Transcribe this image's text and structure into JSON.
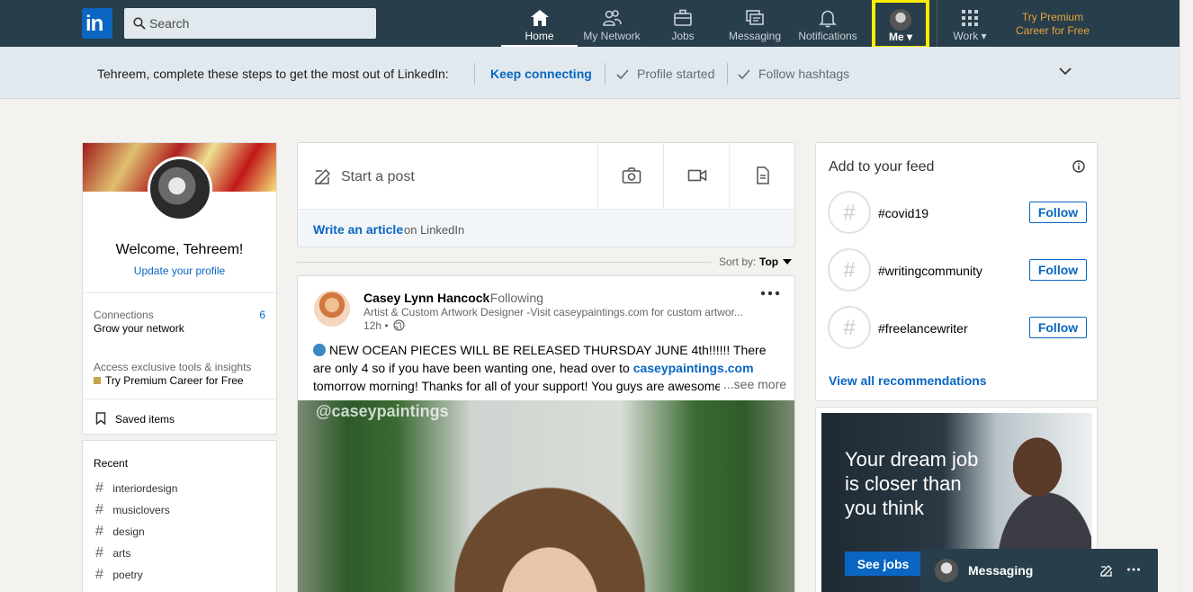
{
  "nav": {
    "logo": "in",
    "search_placeholder": "Search",
    "items": [
      {
        "label": "Home",
        "icon": "home-icon"
      },
      {
        "label": "My Network",
        "icon": "network-icon"
      },
      {
        "label": "Jobs",
        "icon": "briefcase-icon"
      },
      {
        "label": "Messaging",
        "icon": "messaging-icon"
      },
      {
        "label": "Notifications",
        "icon": "bell-icon"
      }
    ],
    "me_label": "Me ▾",
    "work_label": "Work ▾",
    "premium_line1": "Try Premium",
    "premium_line2": "Career for Free"
  },
  "onboarding": {
    "text": "Tehreem, complete these steps to get the most out of LinkedIn:",
    "link": "Keep connecting",
    "step1": "Profile started",
    "step2": "Follow hashtags"
  },
  "profile": {
    "welcome": "Welcome, Tehreem!",
    "update": "Update your profile",
    "connections_label": "Connections",
    "connections_count": "6",
    "grow": "Grow your network",
    "premium_label": "Access exclusive tools & insights",
    "premium_link": "Try Premium Career for Free",
    "saved": "Saved items"
  },
  "recent": {
    "title": "Recent",
    "items": [
      "interiordesign",
      "musiclovers",
      "design",
      "arts",
      "poetry"
    ]
  },
  "share": {
    "start": "Start a post",
    "article": "Write an article",
    "article_suffix": "on LinkedIn"
  },
  "sort": {
    "label": "Sort by:",
    "value": "Top"
  },
  "post": {
    "author": "Casey Lynn Hancock",
    "following": "• Following",
    "headline": "Artist & Custom Artwork Designer -Visit caseypaintings.com for custom artwor...",
    "time": "12h •",
    "text_before": "NEW OCEAN PIECES WILL BE RELEASED THURSDAY JUNE 4th!!!!!! There are only 4 so if you have been wanting one, head over to ",
    "text_link": "caseypaintings.com",
    "text_after": " tomorrow morning! Thanks for all of your support! You guys are awesome!!!",
    "see_more": "...see more",
    "watermark": "@caseypaintings"
  },
  "feed": {
    "title": "Add to your feed",
    "tags": [
      {
        "tag": "#covid19",
        "button": "Follow"
      },
      {
        "tag": "#writingcommunity",
        "button": "Follow"
      },
      {
        "tag": "#freelancewriter",
        "button": "Follow"
      }
    ],
    "view_all": "View all recommendations"
  },
  "ad": {
    "headline": "Your dream job is closer than you think",
    "cta": "See jobs"
  },
  "messaging": {
    "label": "Messaging"
  },
  "colors": {
    "nav_bg": "#283e4a",
    "accent": "#0a66c2",
    "highlight": "#ffee00",
    "premium": "#e7a33e"
  }
}
